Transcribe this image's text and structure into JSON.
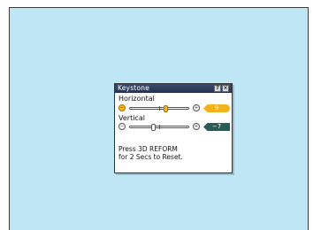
{
  "dialog": {
    "title": "Keystone",
    "help_glyph": "?",
    "close_glyph": "×",
    "horizontal": {
      "label": "Horizontal",
      "value": "9",
      "min_glyph": "−",
      "max_glyph": "+",
      "level": 0.62
    },
    "vertical": {
      "label": "Vertical",
      "value": "−7",
      "min_glyph": "−",
      "max_glyph": "+",
      "level": 0.4
    },
    "message_line1": "Press 3D REFORM",
    "message_line2": "for 2 Secs to Reset."
  },
  "colors": {
    "screen": "#bfe6f5",
    "highlight": "#f2b21c",
    "value_dark": "#2a5c56",
    "titlebar": "#25324f"
  }
}
